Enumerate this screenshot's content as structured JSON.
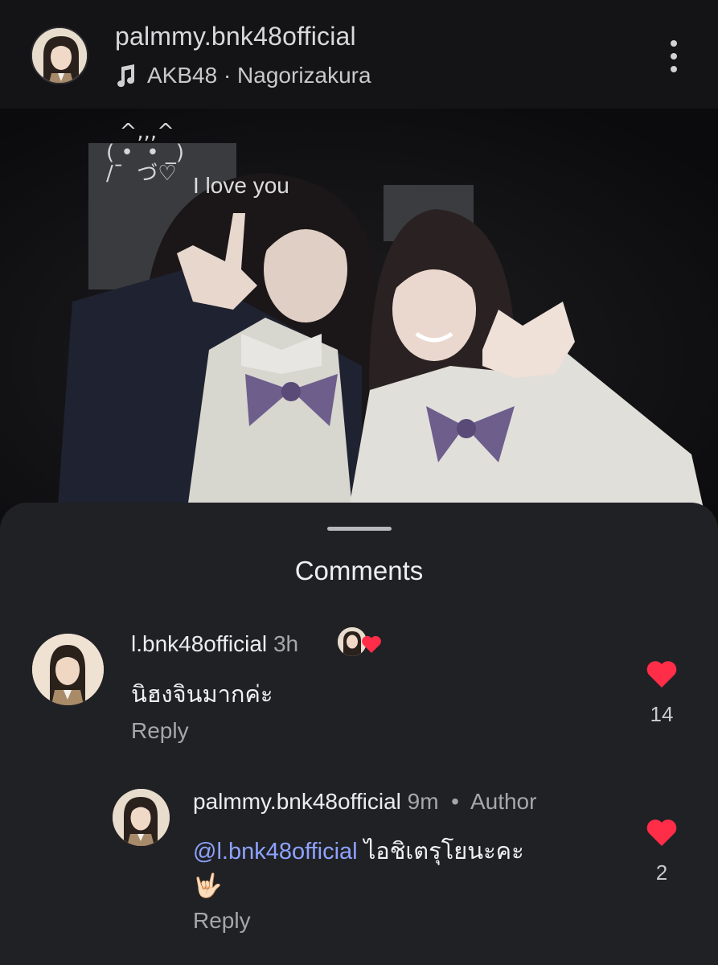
{
  "post": {
    "username": "palmmy.bnk48official",
    "music": "AKB48 · Nagorizakura",
    "kaomoji": "  ^,,,^\n( •  • _)\n/¯  づ♡",
    "caption": "I love you"
  },
  "comments_sheet": {
    "title": "Comments",
    "comments": [
      {
        "username": "l.bnk48official",
        "time": "3h",
        "text": "นิฮงจินมากค่ะ",
        "reply_label": "Reply",
        "likes": "14"
      },
      {
        "username": "palmmy.bnk48official",
        "time": "9m",
        "badge": "Author",
        "mention": "@l.bnk48official",
        "text": "ไอชิเตรุโยนะคะ",
        "emoji": "🤟🏻",
        "reply_label": "Reply",
        "likes": "2"
      }
    ]
  },
  "colors": {
    "background": "#141416",
    "sheet": "#202125",
    "heart": "#ff2d48",
    "mention": "#8ea2ff"
  },
  "icons": [
    "music-note-icon",
    "more-options-icon",
    "heart-icon"
  ]
}
